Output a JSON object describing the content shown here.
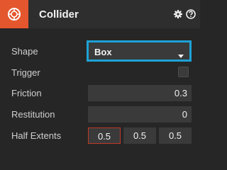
{
  "header": {
    "title": "Collider",
    "component_icon": "collider-icon",
    "settings_icon": "gear-icon",
    "help_icon": "help-icon"
  },
  "colors": {
    "accent": "#e4572e",
    "focus": "#1ea2d6",
    "error": "#c0392b"
  },
  "fields": {
    "shape": {
      "label": "Shape",
      "value": "Box"
    },
    "trigger": {
      "label": "Trigger",
      "checked": false
    },
    "friction": {
      "label": "Friction",
      "value": "0.3"
    },
    "restitution": {
      "label": "Restitution",
      "value": "0"
    },
    "half_extents": {
      "label": "Half Extents",
      "x": "0.5",
      "y": "0.5",
      "z": "0.5"
    }
  }
}
